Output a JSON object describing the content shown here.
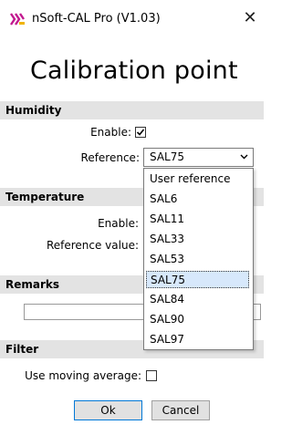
{
  "window": {
    "title": "nSoft-CAL Pro (V1.03)",
    "close_glyph": "✕",
    "icon": "app-logo-icon"
  },
  "heading": "Calibration point",
  "humidity": {
    "section_title": "Humidity",
    "enable_label": "Enable:",
    "enable_checked": true,
    "reference_label": "Reference:",
    "reference_value": "SAL75",
    "chevron": "⌄",
    "options": [
      "User reference",
      "SAL6",
      "SAL11",
      "SAL33",
      "SAL53",
      "SAL75",
      "SAL84",
      "SAL90",
      "SAL97"
    ],
    "selected_option": "SAL75"
  },
  "temperature": {
    "section_title": "Temperature",
    "enable_label": "Enable:",
    "reference_label": "Reference value:"
  },
  "remarks": {
    "section_title": "Remarks",
    "value": ""
  },
  "filter": {
    "section_title": "Filter",
    "moving_average_label": "Use moving average:",
    "moving_average_checked": false
  },
  "buttons": {
    "ok": "Ok",
    "cancel": "Cancel"
  },
  "colors": {
    "section_bg": "#e3e3e3",
    "selection_bg": "#d7e8fb",
    "default_button_border": "#0078d7",
    "logo_magenta": "#c2188f",
    "logo_yellow": "#f0b400"
  }
}
